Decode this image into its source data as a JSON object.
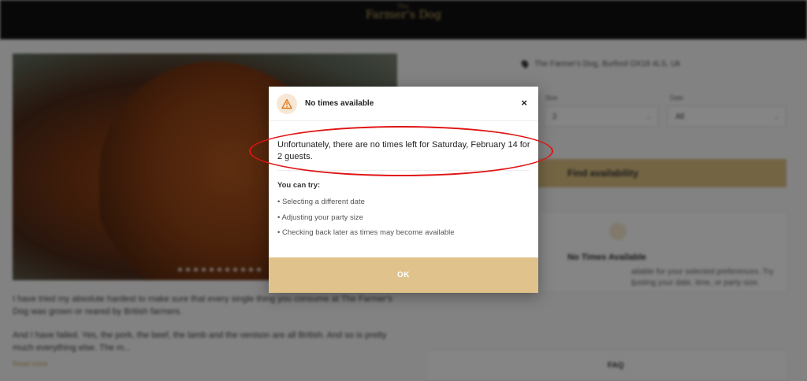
{
  "header": {
    "logo_small": "The",
    "logo_name": "Farmer's Dog"
  },
  "background": {
    "location_label": "The Farmer's Dog, Burford OX18 4LS, Uk",
    "size_label": "Size",
    "size_value": "2",
    "date_label": "Date",
    "date_value": "All",
    "find_button": "Find availability",
    "no_times_title": "No Times Available",
    "no_times_text": "ailable for your selected preferences. Try ljusting your date, time, or party size.",
    "story_p1": "I have tried my absolute hardest to make sure that every single thing you consume at The Farmer's Dog was grown or reared by British farmers.",
    "story_p2": "And I have failed. Yes, the pork, the beef, the lamb and the venison are all British. And so is pretty much everything else. The m...",
    "read_more": "Read more",
    "faq": "FAQ"
  },
  "modal": {
    "title": "No times available",
    "close_label": "×",
    "message": "Unfortunately, there are no times left for Saturday, February 14 for 2 guests.",
    "try_title": "You can try:",
    "suggestions": [
      "• Selecting a different date",
      "• Adjusting your party size",
      "• Checking back later as times may become available"
    ],
    "ok_label": "OK"
  },
  "colors": {
    "accent": "#e0c28c",
    "annotation": "#e01414",
    "warning": "#e07a1f"
  }
}
